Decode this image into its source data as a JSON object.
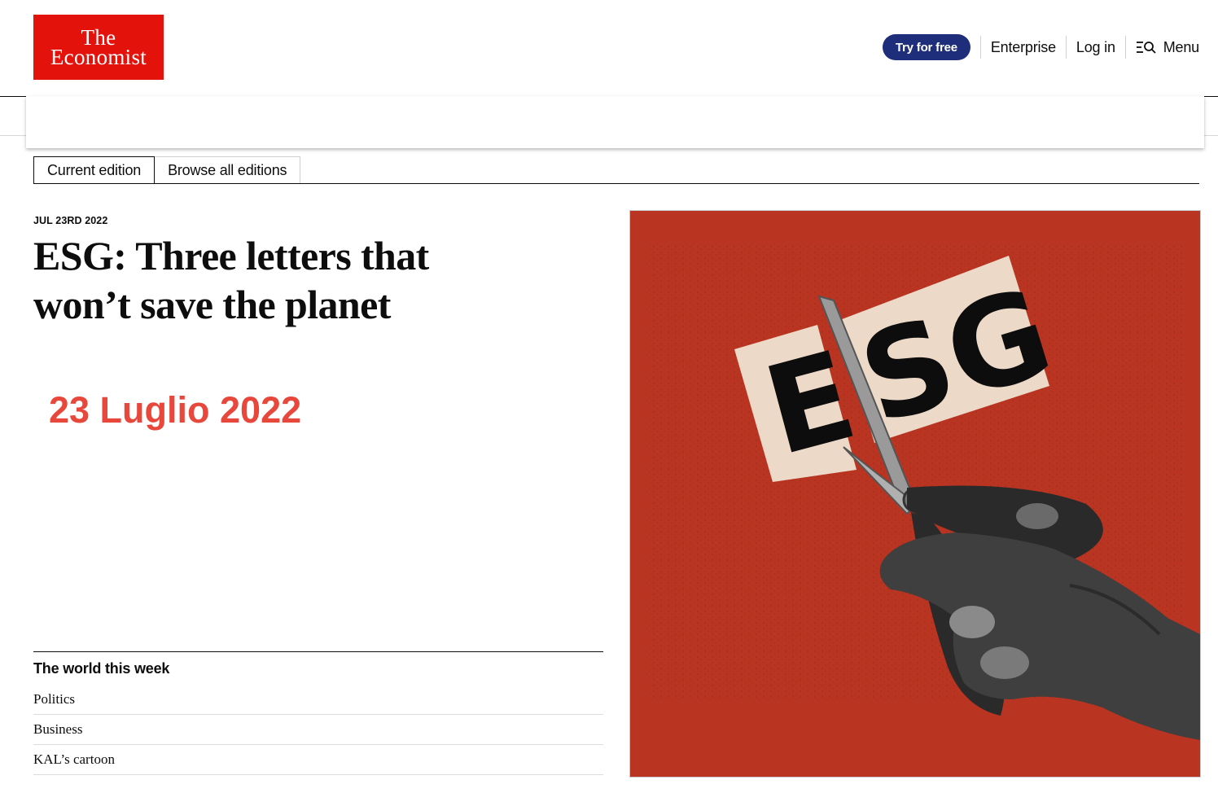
{
  "header": {
    "logo": {
      "line1": "The",
      "line2": "Economist"
    },
    "nav": {
      "try_label": "Try for free",
      "enterprise_label": "Enterprise",
      "login_label": "Log in",
      "menu_label": "Menu"
    }
  },
  "tabs": [
    {
      "label": "Current edition"
    },
    {
      "label": "Browse all editions"
    }
  ],
  "cover": {
    "date": "JUL 23RD 2022",
    "headline": "ESG: Three letters that won’t save the planet",
    "overlay_date": "23 Luglio 2022",
    "image_text": "ESG"
  },
  "section": {
    "title": "The world this week",
    "items": [
      "Politics",
      "Business",
      "KAL’s cartoon"
    ]
  },
  "colors": {
    "brand_red": "#e3120b",
    "button_blue": "#1f2e7a",
    "cover_red": "#b93421",
    "overlay_red": "#e8483c"
  },
  "icons": [
    "menu-search-icon"
  ]
}
